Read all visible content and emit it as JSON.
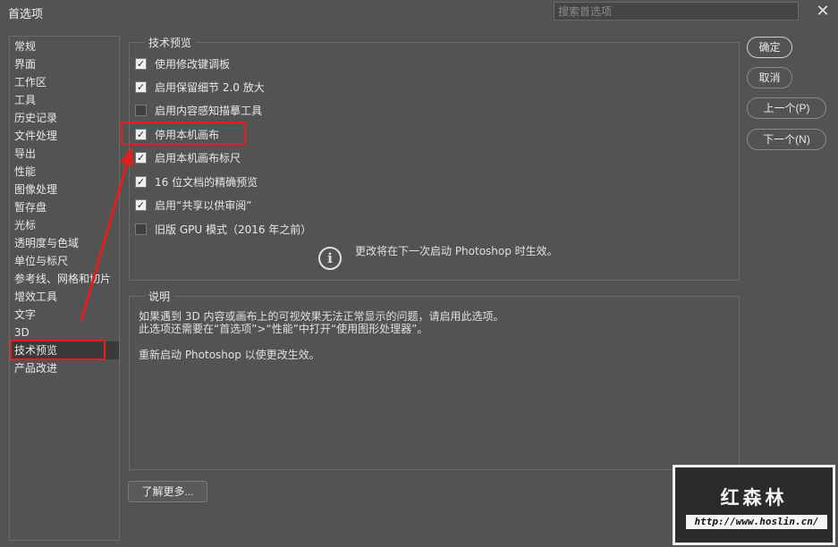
{
  "window": {
    "title": "首选项",
    "search_placeholder": "搜索首选项",
    "close_glyph": "✕"
  },
  "sidebar": {
    "items": [
      {
        "label": "常规"
      },
      {
        "label": "界面"
      },
      {
        "label": "工作区"
      },
      {
        "label": "工具"
      },
      {
        "label": "历史记录"
      },
      {
        "label": "文件处理"
      },
      {
        "label": "导出"
      },
      {
        "label": "性能"
      },
      {
        "label": "图像处理"
      },
      {
        "label": "暂存盘"
      },
      {
        "label": "光标"
      },
      {
        "label": "透明度与色域"
      },
      {
        "label": "单位与标尺"
      },
      {
        "label": "参考线、网格和切片"
      },
      {
        "label": "增效工具"
      },
      {
        "label": "文字"
      },
      {
        "label": "3D"
      },
      {
        "label": "技术预览"
      },
      {
        "label": "产品改进"
      }
    ],
    "active": "技术预览"
  },
  "tech_preview": {
    "title": "技术预览",
    "options": [
      {
        "label": "使用修改键调板",
        "checked": true
      },
      {
        "label": "启用保留细节 2.0 放大",
        "checked": true
      },
      {
        "label": "启用内容感知描摹工具",
        "checked": false
      },
      {
        "label": "停用本机画布",
        "checked": true
      },
      {
        "label": "启用本机画布标尺",
        "checked": true
      },
      {
        "label": "16 位文档的精确预览",
        "checked": true
      },
      {
        "label": "启用“共享以供审阅”",
        "checked": true
      },
      {
        "label": "旧版 GPU 模式（2016 年之前）",
        "checked": false
      }
    ],
    "info_icon": "i",
    "notice": "更改将在下一次启动 Photoshop 时生效。"
  },
  "description": {
    "title": "说明",
    "line1": "如果遇到 3D 内容或画布上的可视效果无法正常显示的问题，请启用此选项。",
    "line2": "此选项还需要在“首选项”>“性能”中打开“使用图形处理器”。",
    "line3": "重新启动 Photoshop 以使更改生效。"
  },
  "buttons": {
    "ok": "确定",
    "cancel": "取消",
    "prev": "上一个(P)",
    "next": "下一个(N)",
    "learn_more": "了解更多..."
  },
  "watermark": {
    "title": "红森林",
    "url": "http://www.hoslin.cn/"
  },
  "colors": {
    "background": "#535353",
    "annotation": "#e02020",
    "checkbox_on": "#f0f0f0"
  }
}
